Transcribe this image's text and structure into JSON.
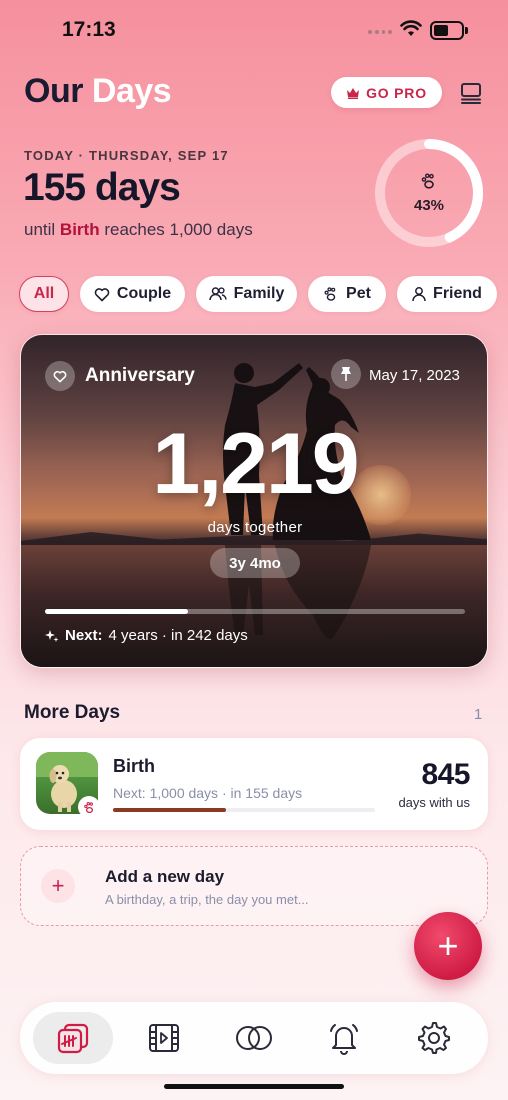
{
  "status": {
    "time": "17:13"
  },
  "header": {
    "title_part1": "Our",
    "title_part2": "Days",
    "go_pro_label": "GO PRO"
  },
  "summary": {
    "today_label": "TODAY · THURSDAY, SEP 17",
    "days_count": "155 days",
    "until_prefix": "until",
    "until_name": "Birth",
    "until_suffix": "reaches 1,000 days",
    "progress_percent": "43%",
    "progress_value": 0.43
  },
  "filters": [
    {
      "label": "All",
      "icon": "none",
      "active": true
    },
    {
      "label": "Couple",
      "icon": "heart-icon",
      "active": false
    },
    {
      "label": "Family",
      "icon": "people-icon",
      "active": false
    },
    {
      "label": "Pet",
      "icon": "paw-icon",
      "active": false
    },
    {
      "label": "Friend",
      "icon": "person-icon",
      "active": false
    }
  ],
  "hero": {
    "category": "Anniversary",
    "date": "May 17, 2023",
    "count": "1,219",
    "subtitle": "days together",
    "duration": "3y 4mo",
    "next_label": "Next:",
    "next_text": "4 years · in 242 days",
    "next_progress": 0.34
  },
  "more_days": {
    "title": "More Days",
    "count": "1",
    "items": [
      {
        "name": "Birth",
        "next": "Next: 1,000 days · in 155 days",
        "number": "845",
        "number_label": "days with us",
        "progress": 0.43
      }
    ]
  },
  "add_card": {
    "title": "Add a new day",
    "subtitle": "A birthday, a trip, the day you met..."
  },
  "fab": {
    "label": "+"
  },
  "colors": {
    "accent": "#c8264a",
    "background_top": "#f6909e",
    "background_bottom": "#fdf3f4"
  },
  "tabs": [
    {
      "name": "tab-days",
      "icon": "calendar-tally-icon",
      "active": true
    },
    {
      "name": "tab-video",
      "icon": "film-icon",
      "active": false
    },
    {
      "name": "tab-couple",
      "icon": "rings-icon",
      "active": false
    },
    {
      "name": "tab-notifications",
      "icon": "bell-icon",
      "active": false
    },
    {
      "name": "tab-settings",
      "icon": "gear-icon",
      "active": false
    }
  ]
}
